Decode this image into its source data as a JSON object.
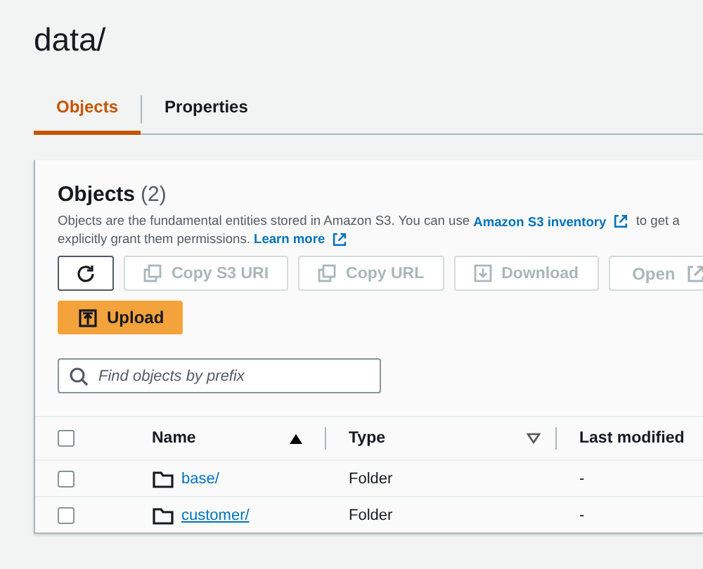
{
  "title": "data/",
  "tabs": [
    {
      "label": "Objects",
      "selected": true
    },
    {
      "label": "Properties",
      "selected": false
    }
  ],
  "panel": {
    "heading": "Objects",
    "count": "(2)",
    "description": [
      {
        "text": "Objects are the fundamental entities stored in Amazon S3. You can use ",
        "link": "Amazon S3 inventory",
        "after": " to get a"
      },
      {
        "text": "explicitly grant them permissions. ",
        "link": "Learn more"
      }
    ],
    "actions": [
      {
        "kind": "refresh",
        "disabled": false
      },
      {
        "kind": "copy",
        "label": "Copy S3 URI",
        "disabled": true
      },
      {
        "kind": "copy",
        "label": "Copy URL",
        "disabled": true
      },
      {
        "kind": "download",
        "label": "Download",
        "disabled": true
      },
      {
        "kind": "open",
        "label": "Open",
        "disabled": true
      },
      {
        "kind": "upload",
        "label": "Upload",
        "disabled": false
      }
    ],
    "search": {
      "placeholder": "Find objects by prefix"
    },
    "table": {
      "select_all": {
        "checked": false
      },
      "columns": [
        {
          "label": "Name",
          "sorted": true
        },
        {
          "label": "Type",
          "sorted": false
        },
        {
          "label": "Last modified"
        }
      ],
      "rows": [
        {
          "checked": false,
          "name": "base/",
          "hovered": false,
          "type": "Folder",
          "last_modified": "-"
        },
        {
          "checked": false,
          "name": "customer/",
          "hovered": true,
          "type": "Folder",
          "last_modified": "-"
        }
      ]
    }
  }
}
